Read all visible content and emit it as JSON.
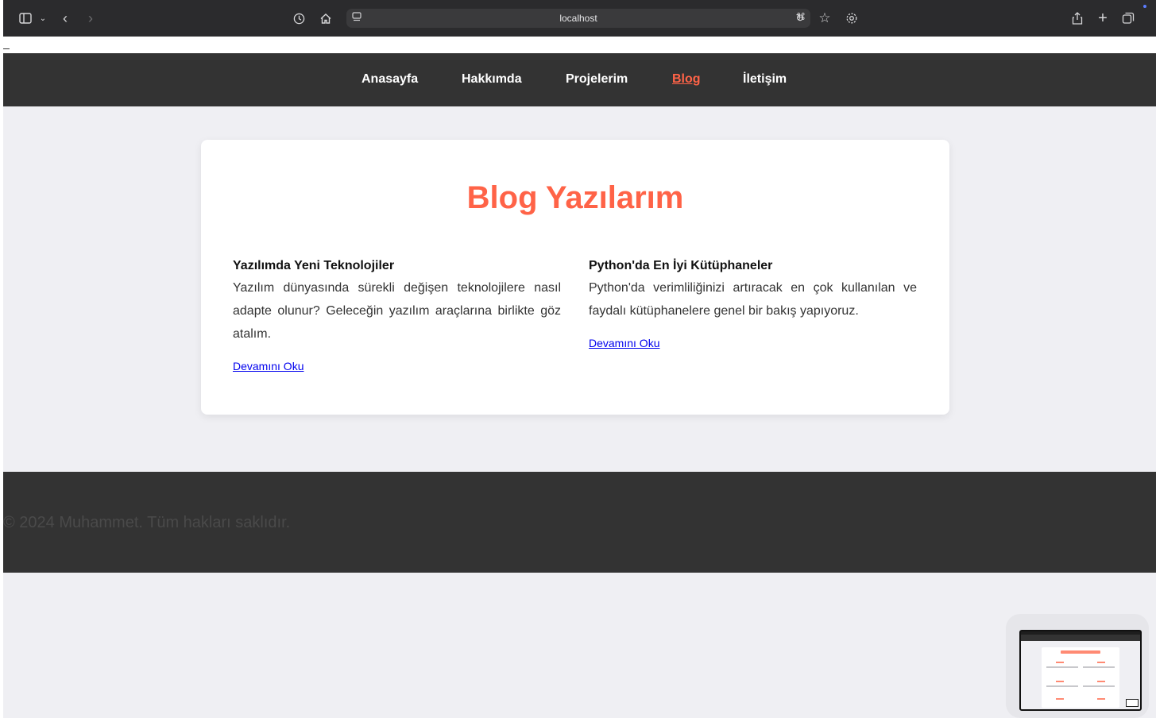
{
  "browser": {
    "url": "localhost",
    "icons": [
      "sidebar-icon",
      "chevron-down-icon",
      "back-icon",
      "forward-icon",
      "history-icon",
      "home-icon",
      "reader-icon",
      "translate-icon",
      "reload-icon",
      "star-icon",
      "gear-icon",
      "share-icon",
      "new-tab-icon",
      "tabs-icon"
    ]
  },
  "nav": {
    "items": [
      {
        "label": "Anasayfa"
      },
      {
        "label": "Hakkımda"
      },
      {
        "label": "Projelerim"
      },
      {
        "label": "Blog",
        "active": true
      },
      {
        "label": "İletişim"
      }
    ]
  },
  "main": {
    "title": "Blog Yazılarım",
    "posts": [
      {
        "title": "Yazılımda Yeni Teknolojiler",
        "body": "Yazılım dünyasında sürekli değişen teknolojilere nasıl adapte olunur? Geleceğin yazılım araçlarına birlikte göz atalım.",
        "link": "Devamını Oku"
      },
      {
        "title": "Python'da En İyi Kütüphaneler",
        "body": "Python'da verimliliğinizi artıracak en çok kullanılan ve faydalı kütüphanelere genel bir bakış yapıyoruz.",
        "link": "Devamını Oku"
      }
    ]
  },
  "footer": {
    "copyright": "© 2024 Muhammet. Tüm hakları saklıdır."
  },
  "colors": {
    "accent": "#ff6347",
    "header_bg": "#333333",
    "page_bg": "#efeff3",
    "link": "#0000ee"
  }
}
